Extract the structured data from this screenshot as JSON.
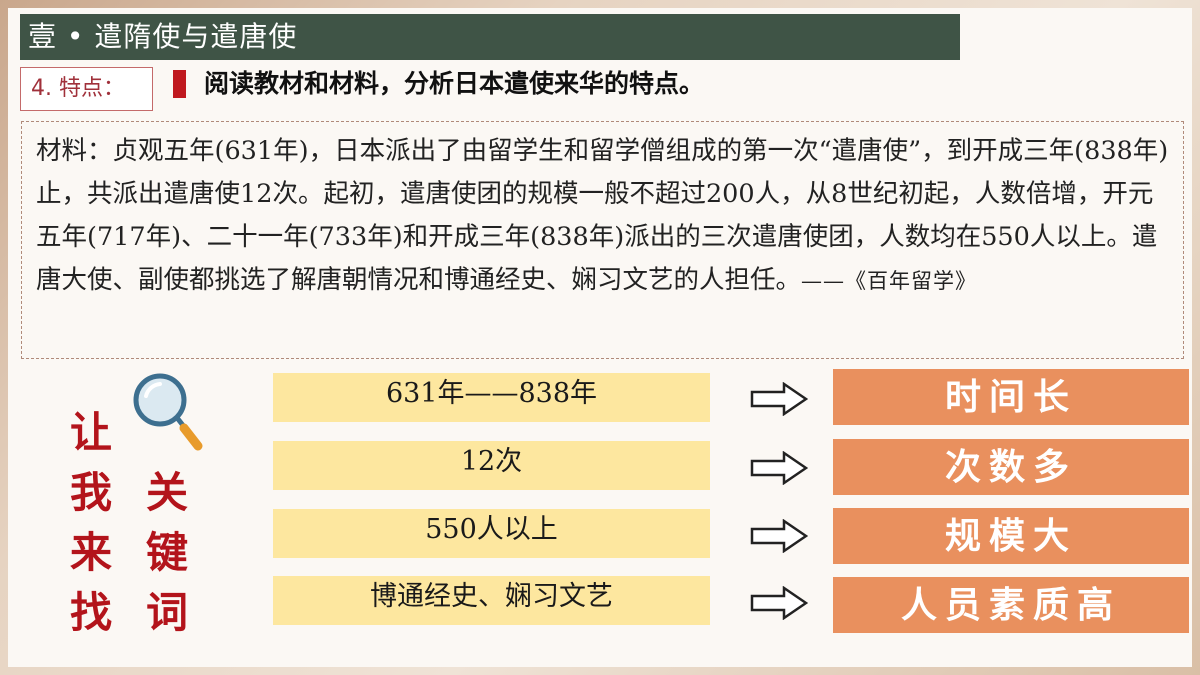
{
  "title": "壹 • 遣隋使与遣唐使",
  "section_tag": "4. 特点：",
  "instruction": "阅读教材和材料，分析日本遣使来华的特点。",
  "material": {
    "text": "材料：贞观五年(631年)，日本派出了由留学生和留学僧组成的第一次“遣唐使”，到开成三年(838年)止，共派出遣唐使12次。起初，遣唐使团的规模一般不超过200人，从8世纪初起，人数倍增，开元五年(717年)、二十一年(733年)和开成三年(838年)派出的三次遣唐使团，人数均在550人以上。遣唐大使、副使都挑选了解唐朝情况和博通经史、娴习文艺的人担任。",
    "source": "——《百年留学》"
  },
  "keywords_label": {
    "col1": [
      "让",
      "我",
      "来",
      "找"
    ],
    "col2": [
      "关",
      "键",
      "词"
    ]
  },
  "rows": [
    {
      "phrase": "631年——838年",
      "result": "时间长"
    },
    {
      "phrase": "12次",
      "result": "次数多"
    },
    {
      "phrase": "550人以上",
      "result": "规模大"
    },
    {
      "phrase": "博通经史、娴习文艺",
      "result": "人员素质高"
    }
  ],
  "colors": {
    "title_bar": "#3f5446",
    "accent_red": "#c0191f",
    "phrase_bg": "#fde79f",
    "result_bg": "#e9905e"
  },
  "icons": {
    "magnifier": "magnifier-icon",
    "arrow": "outline-right-arrow-icon"
  }
}
